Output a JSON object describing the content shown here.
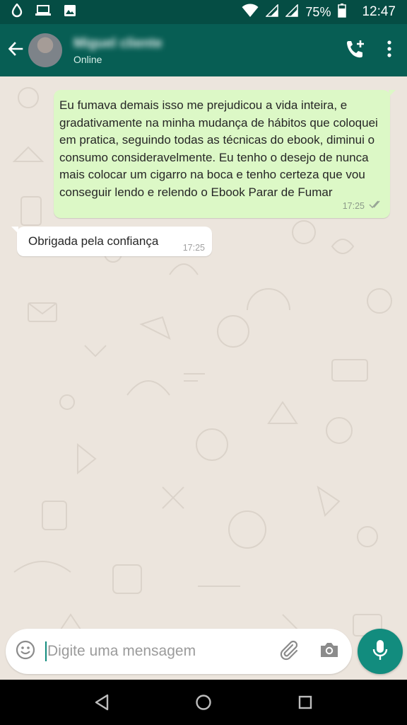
{
  "status_bar": {
    "battery_percent": "75%",
    "time": "12:47",
    "icons": [
      "water-drop-icon",
      "monitor-icon",
      "image-icon",
      "wifi-icon",
      "signal-icon",
      "signal-icon",
      "battery-icon"
    ]
  },
  "header": {
    "contact_name": "Miguel cliente",
    "status": "Online"
  },
  "messages": {
    "outgoing_text": "Eu fumava demais isso me prejudicou a vida inteira, e gradativamente na minha mudança de hábitos que coloquei em pratica, seguindo todas as técnicas do ebook, diminui o consumo consideravelmente. Eu tenho o desejo de nunca mais colocar um cigarro na boca e tenho certeza que vou conseguir lendo e relendo o Ebook Parar de Fumar",
    "outgoing_time": "17:25",
    "incoming_text": "Obrigada pela confiança",
    "incoming_time": "17:25"
  },
  "composer": {
    "placeholder": "Digite uma mensagem"
  },
  "colors": {
    "header": "#075e54",
    "status_bar": "#054d44",
    "outgoing_bubble": "#dcf8c6",
    "accent": "#128c7e",
    "chat_bg": "#ece5dd"
  }
}
